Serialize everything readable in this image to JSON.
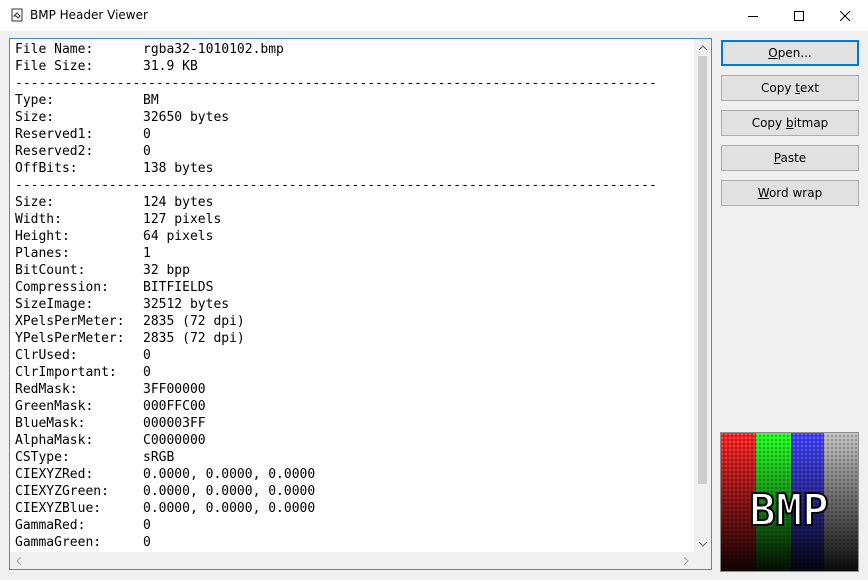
{
  "window": {
    "title": "BMP Header Viewer",
    "controls": {
      "minimize": "minimize-icon",
      "maximize": "maximize-icon",
      "close": "close-icon"
    }
  },
  "header_info": [
    {
      "label": "File Name:",
      "value": "rgba32-1010102.bmp"
    },
    {
      "label": "File Size:",
      "value": "31.9 KB"
    },
    {
      "separator": "----------------------------------------------------------------------------------"
    },
    {
      "label": "Type:",
      "value": "BM"
    },
    {
      "label": "Size:",
      "value": "32650 bytes"
    },
    {
      "label": "Reserved1:",
      "value": "0"
    },
    {
      "label": "Reserved2:",
      "value": "0"
    },
    {
      "label": "OffBits:",
      "value": "138 bytes"
    },
    {
      "separator": "----------------------------------------------------------------------------------"
    },
    {
      "label": "Size:",
      "value": "124 bytes"
    },
    {
      "label": "Width:",
      "value": "127 pixels"
    },
    {
      "label": "Height:",
      "value": "64 pixels"
    },
    {
      "label": "Planes:",
      "value": "1"
    },
    {
      "label": "BitCount:",
      "value": "32 bpp"
    },
    {
      "label": "Compression:",
      "value": "BITFIELDS"
    },
    {
      "label": "SizeImage:",
      "value": "32512 bytes"
    },
    {
      "label": "XPelsPerMeter:",
      "value": "2835 (72 dpi)"
    },
    {
      "label": "YPelsPerMeter:",
      "value": "2835 (72 dpi)"
    },
    {
      "label": "ClrUsed:",
      "value": "0"
    },
    {
      "label": "ClrImportant:",
      "value": "0"
    },
    {
      "label": "RedMask:",
      "value": "3FF00000"
    },
    {
      "label": "GreenMask:",
      "value": "000FFC00"
    },
    {
      "label": "BlueMask:",
      "value": "000003FF"
    },
    {
      "label": "AlphaMask:",
      "value": "C0000000"
    },
    {
      "label": "CSType:",
      "value": "sRGB"
    },
    {
      "label": "CIEXYZRed:",
      "value": "0.0000, 0.0000, 0.0000"
    },
    {
      "label": "CIEXYZGreen:",
      "value": "0.0000, 0.0000, 0.0000"
    },
    {
      "label": "CIEXYZBlue:",
      "value": "0.0000, 0.0000, 0.0000"
    },
    {
      "label": "GammaRed:",
      "value": "0"
    },
    {
      "label": "GammaGreen:",
      "value": "0"
    }
  ],
  "buttons": [
    {
      "name": "open-button",
      "pre": "",
      "key": "O",
      "post": "pen...",
      "default": true
    },
    {
      "name": "copy-text-button",
      "pre": "Copy ",
      "key": "t",
      "post": "ext",
      "default": false
    },
    {
      "name": "copy-bitmap-button",
      "pre": "Copy ",
      "key": "b",
      "post": "itmap",
      "default": false
    },
    {
      "name": "paste-button",
      "pre": "",
      "key": "P",
      "post": "aste",
      "default": false
    },
    {
      "name": "word-wrap-button",
      "pre": "",
      "key": "W",
      "post": "ord wrap",
      "default": false
    }
  ],
  "preview": {
    "text": "BMP",
    "icon": "bmp-preview-image",
    "colors": [
      "#ff2020",
      "#20ff20",
      "#4040ff",
      "#c0c0c0"
    ]
  },
  "scrollbar_icons": {
    "up": "arrow-up-icon",
    "down": "arrow-down-icon",
    "left": "arrow-left-icon",
    "right": "arrow-right-icon"
  }
}
